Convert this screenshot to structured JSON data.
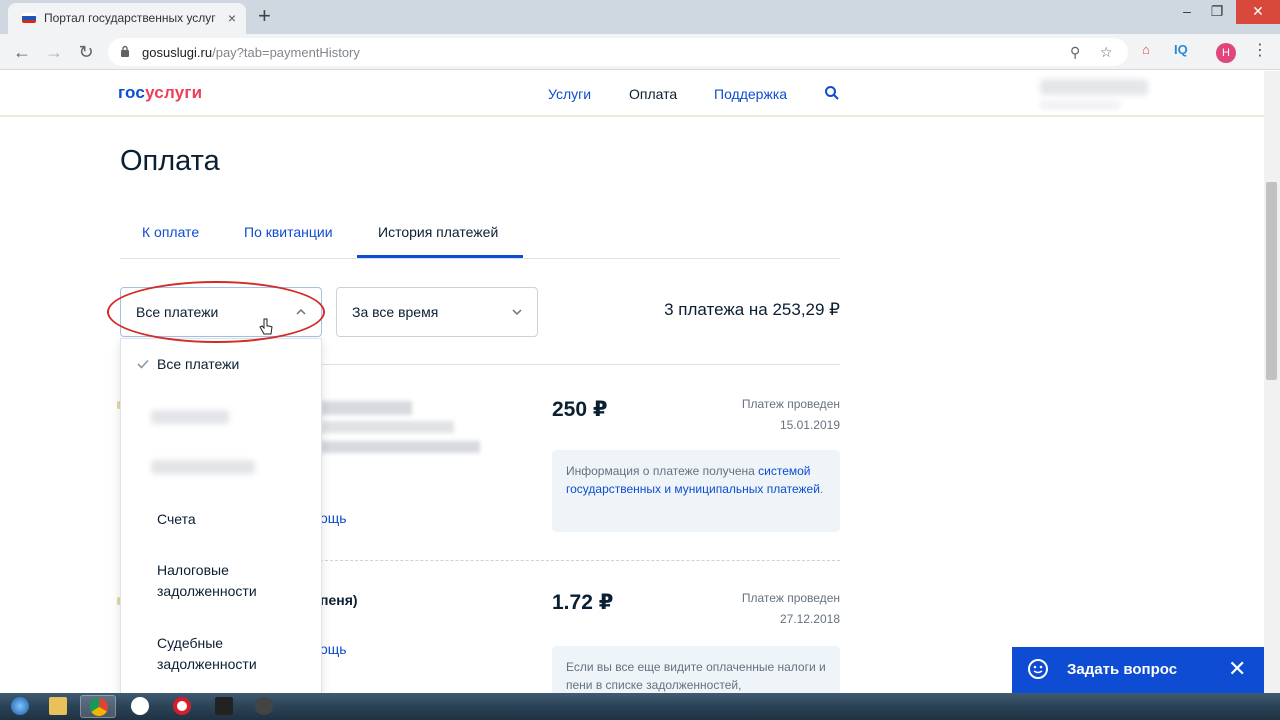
{
  "browser": {
    "tab_title": "Портал государственных услуг",
    "tab_close": "×",
    "new_tab": "+",
    "url_host": "gosuslugi.ru",
    "url_path": "/pay?tab=paymentHistory",
    "ext_iq": "IQ",
    "profile_initial": "Н"
  },
  "header": {
    "logo_part1": "гос",
    "logo_part2": "услуги",
    "nav": [
      "Услуги",
      "Оплата",
      "Поддержка"
    ]
  },
  "page": {
    "title": "Оплата",
    "tabs": [
      "К оплате",
      "По квитанции",
      "История платежей"
    ],
    "active_tab": "История платежей"
  },
  "filters": {
    "type_value": "Все платежи",
    "period_value": "За все время",
    "total": "3 платежа на 253,29 ₽"
  },
  "dropdown": {
    "items": [
      "Все платежи",
      "Счета",
      "Налоговые задолженности",
      "Судебные задолженности"
    ],
    "selected": "Все платежи"
  },
  "payments": [
    {
      "amount": "250 ₽",
      "status": "Платеж проведен",
      "date": "15.01.2019",
      "info_prefix": "Информация о платеже получена ",
      "info_link": "системой государственных и муниципальных платежей",
      "info_suffix": ".",
      "link_fragment": "ощь"
    },
    {
      "amount": "1.72 ₽",
      "status": "Платеж проведен",
      "date": "27.12.2018",
      "title_fragment": "пеня)",
      "info": "Если вы все еще видите оплаченные налоги и пени в списке задолженностей,",
      "link_fragment": "ощь"
    }
  ],
  "ask_widget": {
    "label": "Задать вопрос",
    "close": "✕"
  },
  "colors": {
    "brand_blue": "#0d4cd3",
    "brand_red": "#ee3f58",
    "annotation_red": "#d42a2a",
    "text_dark": "#0b1f33"
  }
}
